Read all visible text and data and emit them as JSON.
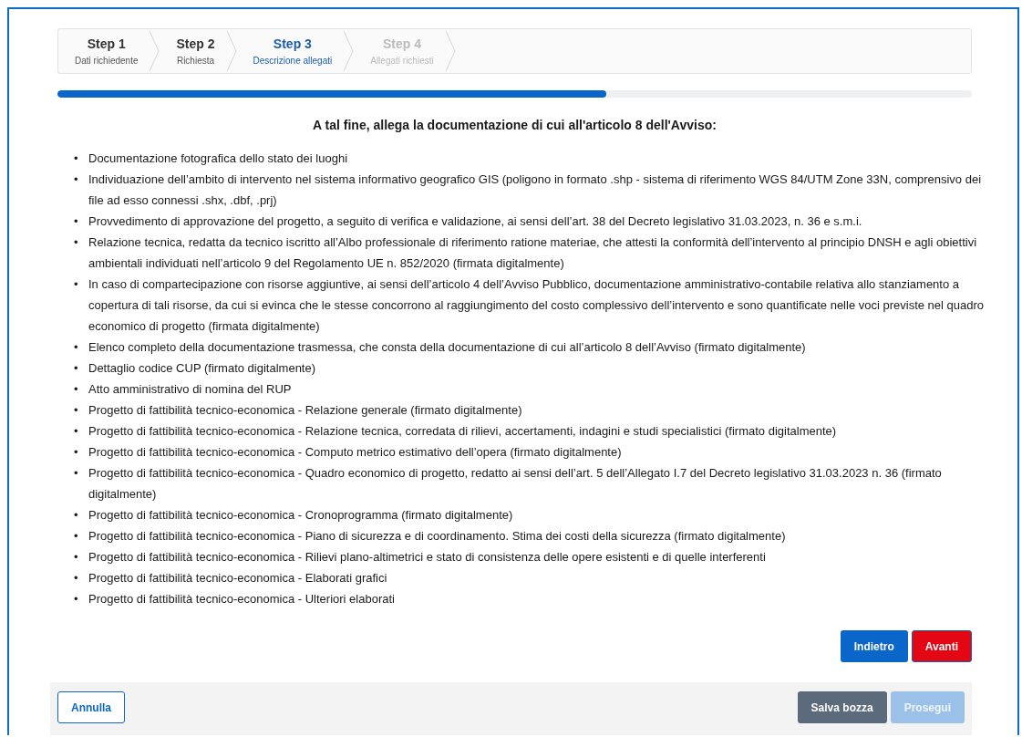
{
  "steps": [
    {
      "title": "Step 1",
      "subtitle": "Dati richiedente",
      "selected": false,
      "disabled": false
    },
    {
      "title": "Step 2",
      "subtitle": "Richiesta",
      "selected": false,
      "disabled": false
    },
    {
      "title": "Step 3",
      "subtitle": "Descrizione allegati",
      "selected": true,
      "disabled": false
    },
    {
      "title": "Step 4",
      "subtitle": "Allegati richiesti",
      "selected": false,
      "disabled": true
    }
  ],
  "progress": {
    "level": 0.6
  },
  "heading": "A tal fine, allega la documentazione di cui all'articolo 8 dell'Avviso:",
  "items": [
    {
      "bullet": "•",
      "text": "Documentazione fotografica dello stato dei luoghi"
    },
    {
      "bullet": "•",
      "text": "Individuazione dell’ambito di intervento nel sistema informativo geografico GIS (poligono in formato .shp - sistema di riferimento WGS 84/UTM Zone 33N, comprensivo dei file ad esso connessi .shx, .dbf, .prj)"
    },
    {
      "bullet": "•",
      "text": "Provvedimento di approvazione del progetto, a seguito di verifica e validazione, ai sensi dell’art. 38 del Decreto legislativo 31.03.2023, n. 36 e s.m.i."
    },
    {
      "bullet": "•",
      "text": "Relazione tecnica, redatta da tecnico iscritto all’Albo professionale di riferimento ratione materiae, che attesti la conformità dell’intervento al principio DNSH e agli obiettivi ambientali individuati nell’articolo 9 del Regolamento UE n. 852/2020 (firmata digitalmente)"
    },
    {
      "bullet": "•",
      "text": "In caso di compartecipazione con risorse aggiuntive, ai sensi dell’articolo 4 dell’Avviso Pubblico, documentazione amministrativo-contabile relativa allo stanziamento a copertura di tali risorse, da cui si evinca che le stesse concorrono al raggiungimento del costo complessivo dell’intervento e sono quantificate nelle voci previste nel quadro economico di progetto (firmata digitalmente)"
    },
    {
      "bullet": "•",
      "text": "Elenco completo della documentazione trasmessa, che consta della documentazione di cui all’articolo 8 dell’Avviso (firmato digitalmente)"
    },
    {
      "bullet": "•",
      "text": "Dettaglio codice CUP (firmato digitalmente)"
    },
    {
      "bullet": "•",
      "text": "Atto amministrativo di nomina del RUP"
    },
    {
      "bullet": "•",
      "text": "Progetto di fattibilità tecnico-economica - Relazione generale (firmato digitalmente)"
    },
    {
      "bullet": "•",
      "text": "Progetto di fattibilità tecnico-economica - Relazione tecnica, corredata di rilievi, accertamenti, indagini e studi specialistici (firmato digitalmente)"
    },
    {
      "bullet": "•",
      "text": "Progetto di fattibilità tecnico-economica - Computo metrico estimativo dell’opera (firmato digitalmente)"
    },
    {
      "bullet": "•",
      "text": "Progetto di fattibilità tecnico-economica - Quadro economico di progetto, redatto ai sensi dell’art. 5 dell’Allegato I.7 del Decreto legislativo 31.03.2023 n. 36 (firmato digitalmente)"
    },
    {
      "bullet": "•",
      "text": "Progetto di fattibilità tecnico-economica - Cronoprogramma (firmato digitalmente)"
    },
    {
      "bullet": "•",
      "text": "Progetto di fattibilità tecnico-economica - Piano di sicurezza e di coordinamento. Stima dei costi della sicurezza (firmato digitalmente)"
    },
    {
      "bullet": "•",
      "text": "Progetto di fattibilità tecnico-economica - Rilievi plano-altimetrici e stato di consistenza delle opere esistenti e di quelle interferenti"
    },
    {
      "bullet": "•",
      "text": "Progetto di fattibilità tecnico-economica - Elaborati grafici"
    },
    {
      "bullet": "•",
      "text": "Progetto di fattibilità tecnico-economica - Ulteriori elaborati"
    }
  ],
  "nav_buttons": [
    {
      "label": "Indietro",
      "kind": "primary"
    },
    {
      "label": "Avanti",
      "kind": "danger"
    }
  ],
  "footer": {
    "left": [
      {
        "label": "Annulla",
        "kind": "outline"
      }
    ],
    "right": [
      {
        "label": "Salva bozza",
        "kind": "secondary"
      },
      {
        "label": "Prosegui",
        "kind": "disabled"
      }
    ]
  }
}
